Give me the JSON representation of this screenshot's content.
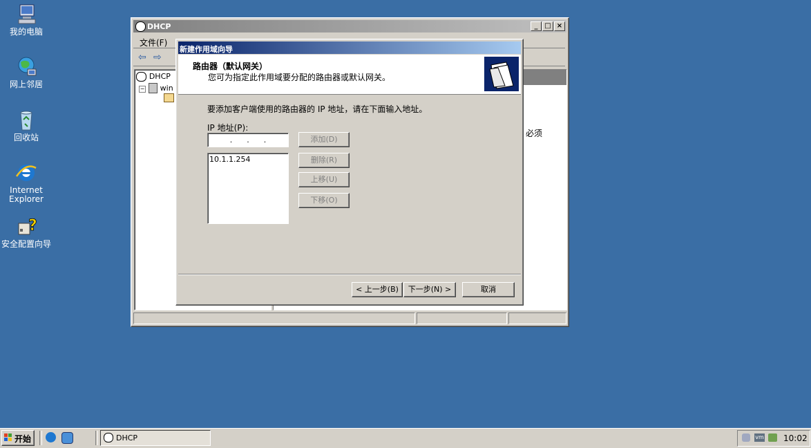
{
  "desktop": {
    "icons": [
      {
        "label": "我的电脑",
        "icon": "my-computer-icon"
      },
      {
        "label": "网上邻居",
        "icon": "network-places-icon"
      },
      {
        "label": "回收站",
        "icon": "recycle-bin-icon"
      },
      {
        "label_line1": "Internet",
        "label_line2": "Explorer",
        "icon": "internet-explorer-icon"
      },
      {
        "label": "安全配置向导",
        "icon": "security-wizard-icon"
      }
    ]
  },
  "dhcp_window": {
    "title": "DHCP",
    "menu": {
      "file": "文件(F)"
    },
    "tree": {
      "root": "DHCP",
      "server": "win"
    },
    "right_text": "必须"
  },
  "wizard": {
    "title": "新建作用域向导",
    "header_title": "路由器（默认网关）",
    "header_subtitle": "您可为指定此作用域要分配的路由器或默认网关。",
    "instruction": "要添加客户端使用的路由器的 IP 地址，请在下面输入地址。",
    "ip_label": "IP 地址(P):",
    "ip_placeholder": ".      .      .",
    "list_items": [
      "10.1.1.254"
    ],
    "buttons": {
      "add": "添加(D)",
      "remove": "删除(R)",
      "up": "上移(U)",
      "down": "下移(O)",
      "back": "< 上一步(B)",
      "next": "下一步(N) >",
      "cancel": "取消"
    }
  },
  "taskbar": {
    "start": "开始",
    "task_label": "DHCP",
    "clock": "10:02"
  },
  "colors": {
    "desktop": "#3a6ea5",
    "title_active": "#0a246a",
    "title_inactive": "#808080"
  }
}
